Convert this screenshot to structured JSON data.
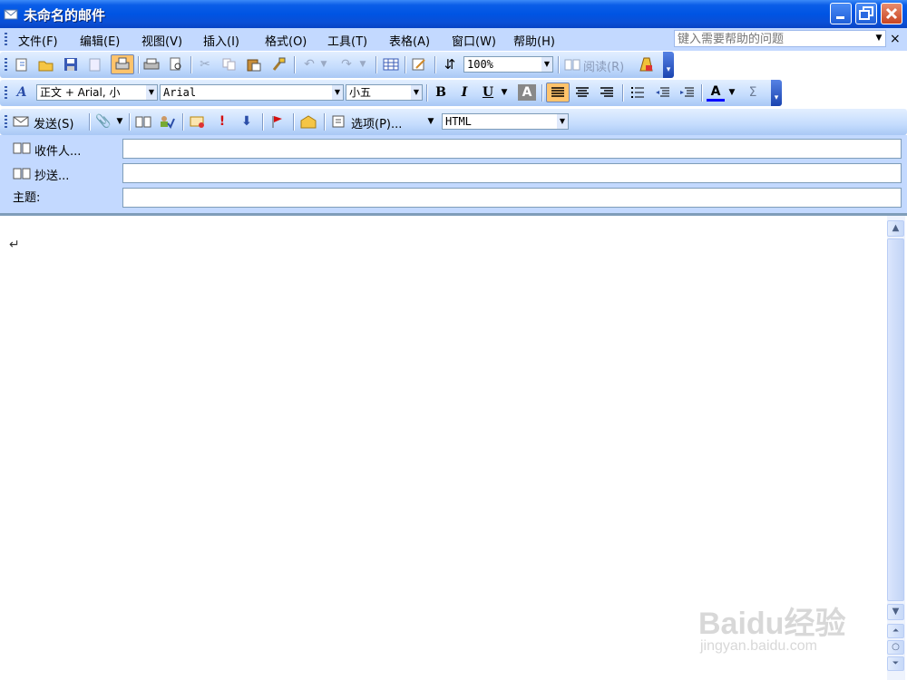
{
  "window": {
    "title": "未命名的邮件"
  },
  "menubar": {
    "items": [
      "文件(F)",
      "编辑(E)",
      "视图(V)",
      "插入(I)",
      "格式(O)",
      "工具(T)",
      "表格(A)",
      "窗口(W)",
      "帮助(H)"
    ],
    "help_placeholder": "键入需要帮助的问题",
    "close_glyph": "×"
  },
  "standard_toolbar": {
    "zoom": "100%",
    "read_label": "阅读(R)"
  },
  "format_toolbar": {
    "style": "正文 + Arial, 小",
    "font": "Arial",
    "size": "小五",
    "bold": "B",
    "italic": "I",
    "underline": "U",
    "font_color_glyph": "A",
    "sum_glyph": "Σ"
  },
  "mail_toolbar": {
    "send_label": "发送(S)",
    "options_label": "选项(P)...",
    "format": "HTML"
  },
  "header": {
    "to_label": "收件人...",
    "cc_label": "抄送...",
    "subject_label": "主题:",
    "to_value": "",
    "cc_value": "",
    "subject_value": ""
  },
  "body": {
    "text": "",
    "para_mark": "↵"
  },
  "watermark": {
    "line1": "Baidu经验",
    "line2": "jingyan.baidu.com"
  },
  "icons": [
    "mail-icon",
    "new-icon",
    "open-icon",
    "save-icon",
    "permission-icon",
    "print-preview-icon",
    "print-icon",
    "cut-icon",
    "copy-icon",
    "paste-icon",
    "format-painter-icon",
    "undo-icon",
    "redo-icon",
    "table-icon",
    "drawing-icon",
    "docmap-icon",
    "book-icon",
    "attach-icon",
    "address-book-icon",
    "check-names-icon",
    "importance-high-icon",
    "importance-low-icon",
    "flag-icon",
    "envelope-icon"
  ],
  "colors": {
    "title_bar": "#0054e3",
    "menubar": "#c3d9ff",
    "active_button": "#ffc36b",
    "font_color": "#0000ff"
  }
}
